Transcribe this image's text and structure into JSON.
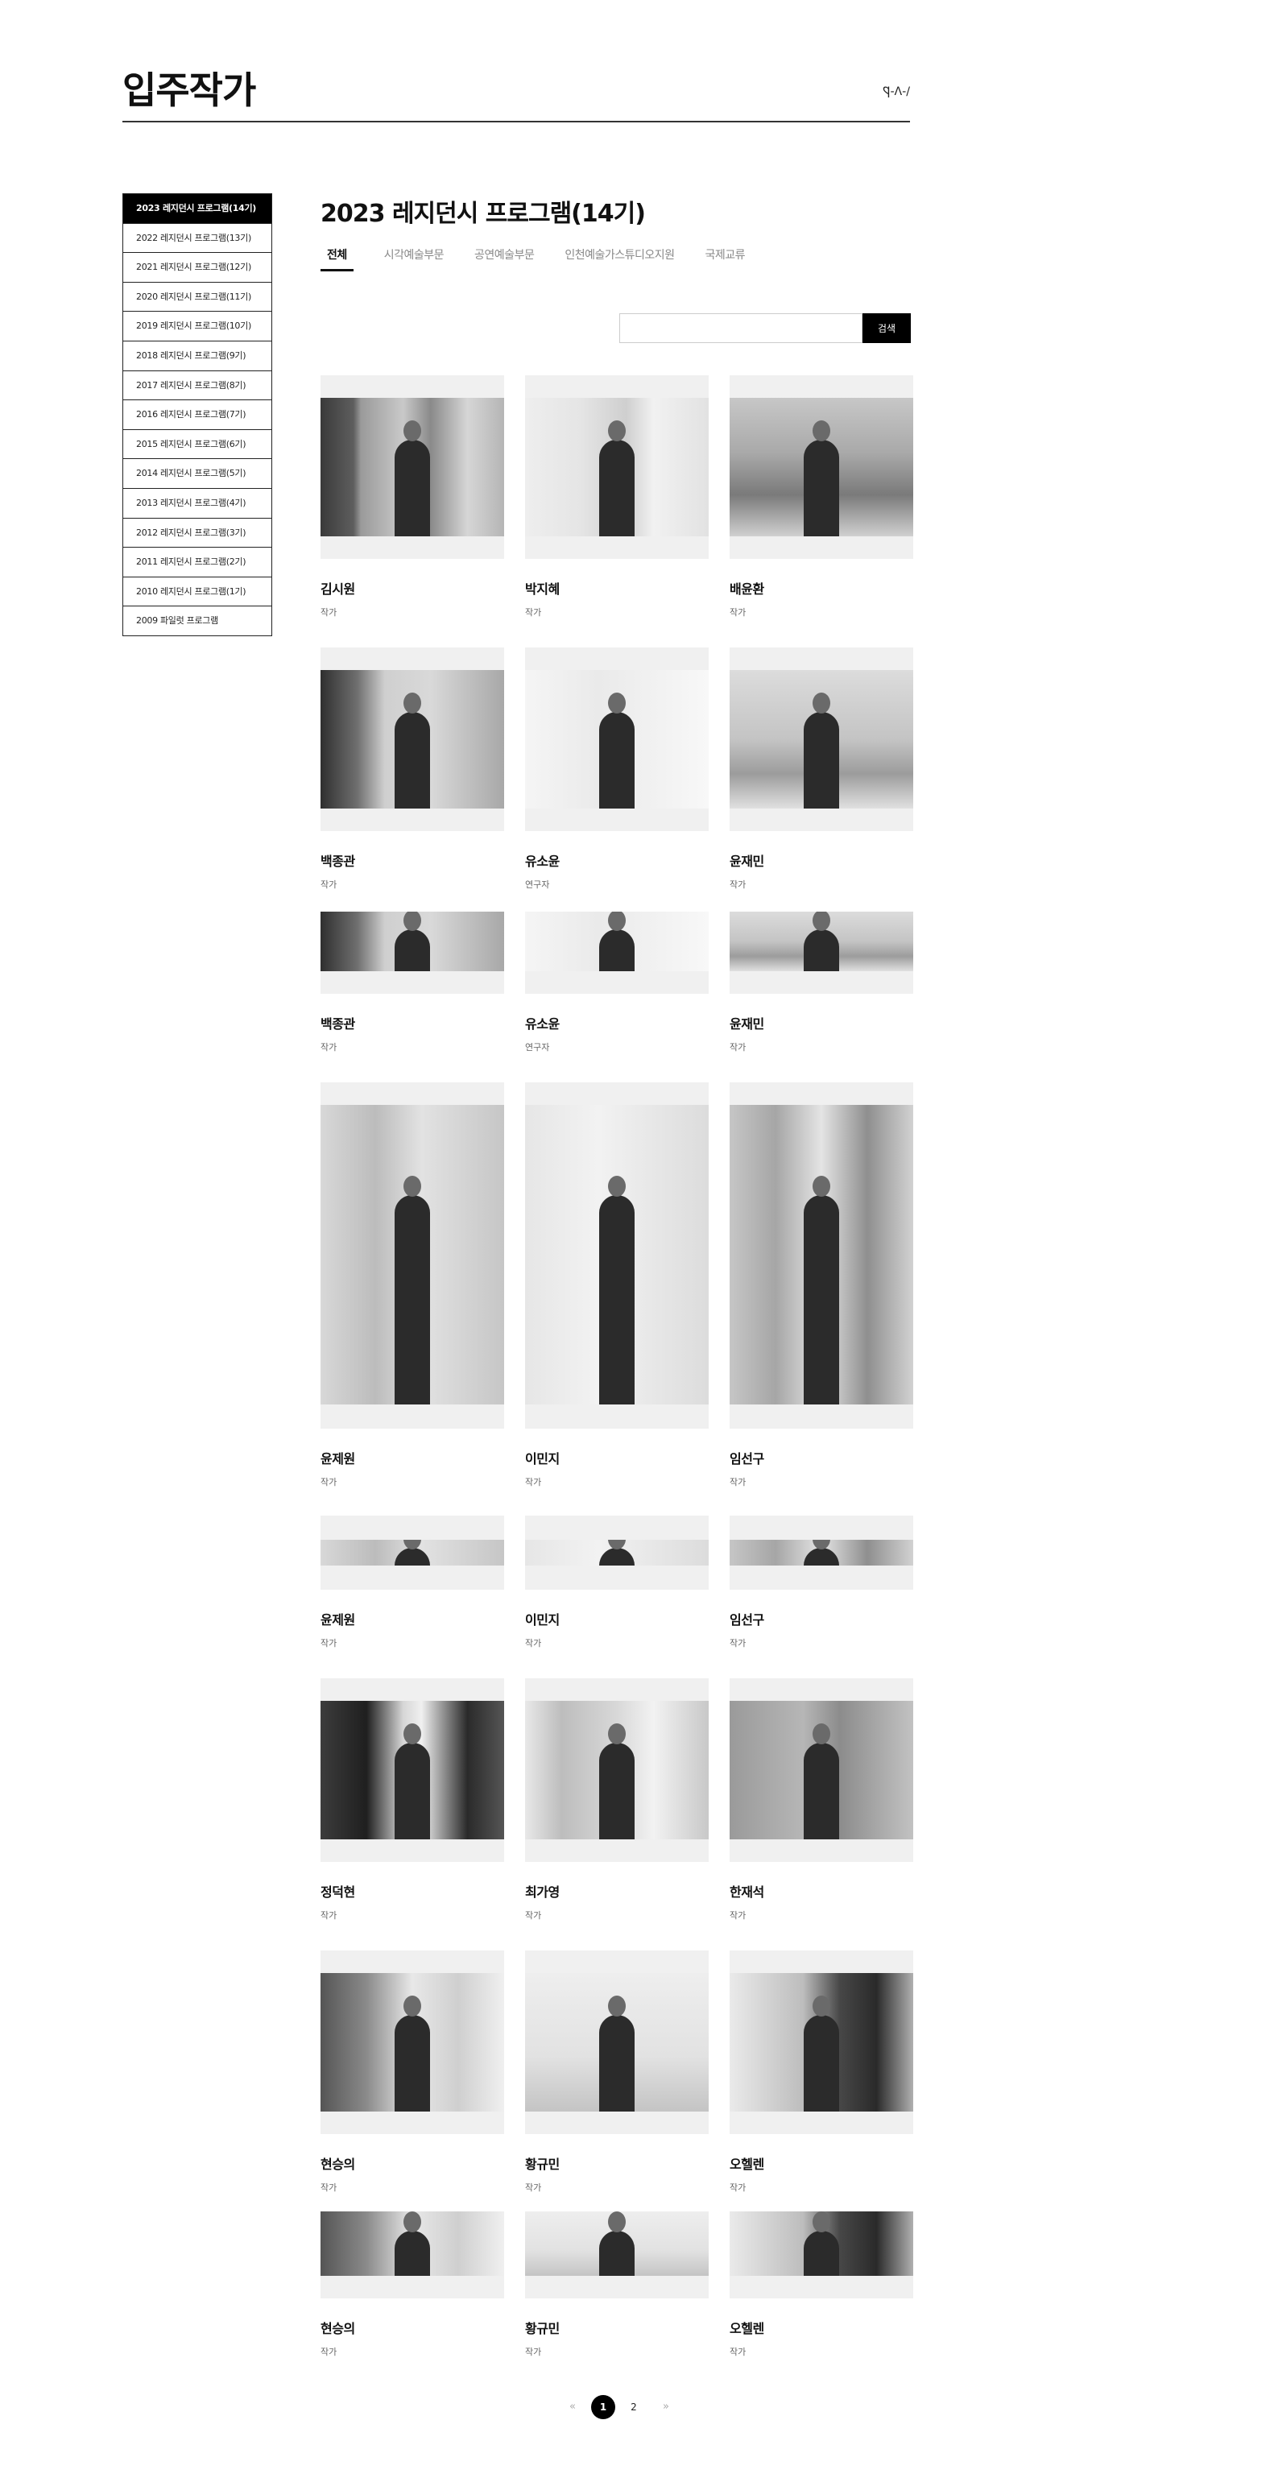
{
  "header": {
    "title": "입주작가",
    "breadcrumb": "\\-Ʌ-Ƿ"
  },
  "sidebar": {
    "items": [
      {
        "label": "2023 레지던시 프로그램(14기)",
        "active": true
      },
      {
        "label": "2022 레지던시 프로그램(13기)"
      },
      {
        "label": "2021 레지던시 프로그램(12기)"
      },
      {
        "label": "2020 레지던시 프로그램(11기)"
      },
      {
        "label": "2019 레지던시 프로그램(10기)"
      },
      {
        "label": "2018 레지던시 프로그램(9기)"
      },
      {
        "label": "2017 레지던시 프로그램(8기)"
      },
      {
        "label": "2016 레지던시 프로그램(7기)"
      },
      {
        "label": "2015 레지던시 프로그램(6기)"
      },
      {
        "label": "2014 레지던시 프로그램(5기)"
      },
      {
        "label": "2013 레지던시 프로그램(4기)"
      },
      {
        "label": "2012 레지던시 프로그램(3기)"
      },
      {
        "label": "2011 레지던시 프로그램(2기)"
      },
      {
        "label": "2010 레지던시 프로그램(1기)"
      },
      {
        "label": "2009 파일럿 프로그램"
      }
    ]
  },
  "main": {
    "title": "2023 레지던시 프로그램(14기)",
    "tabs": [
      {
        "label": "전체",
        "active": true
      },
      {
        "label": "시각예술부문"
      },
      {
        "label": "공연예술부문"
      },
      {
        "label": "인천예술가스튜디오지원"
      },
      {
        "label": "국제교류"
      }
    ],
    "search": {
      "placeholder": "",
      "button_label": "검색"
    }
  },
  "artists": [
    {
      "name": "김시원",
      "role": "작가"
    },
    {
      "name": "박지혜",
      "role": "작가"
    },
    {
      "name": "배윤환",
      "role": "작가"
    },
    {
      "name": "백종관",
      "role": "작가"
    },
    {
      "name": "유소윤",
      "role": "연구자"
    },
    {
      "name": "윤재민",
      "role": "작가"
    },
    {
      "name": "백종관",
      "role": "작가"
    },
    {
      "name": "유소윤",
      "role": "연구자"
    },
    {
      "name": "윤재민",
      "role": "작가"
    },
    {
      "name": "윤제원",
      "role": "작가"
    },
    {
      "name": "이민지",
      "role": "작가"
    },
    {
      "name": "임선구",
      "role": "작가"
    },
    {
      "name": "윤제원",
      "role": "작가"
    },
    {
      "name": "이민지",
      "role": "작가"
    },
    {
      "name": "임선구",
      "role": "작가"
    },
    {
      "name": "정덕현",
      "role": "작가"
    },
    {
      "name": "최가영",
      "role": "작가"
    },
    {
      "name": "한재석",
      "role": "작가"
    },
    {
      "name": "현승의",
      "role": "작가"
    },
    {
      "name": "황규민",
      "role": "작가"
    },
    {
      "name": "오헬렌",
      "role": "작가"
    },
    {
      "name": "현승의",
      "role": "작가"
    },
    {
      "name": "황규민",
      "role": "작가"
    },
    {
      "name": "오헬렌",
      "role": "작가"
    }
  ],
  "pagination": {
    "prev": "«",
    "pages": [
      "1",
      "2"
    ],
    "current": "1",
    "next": "»"
  }
}
